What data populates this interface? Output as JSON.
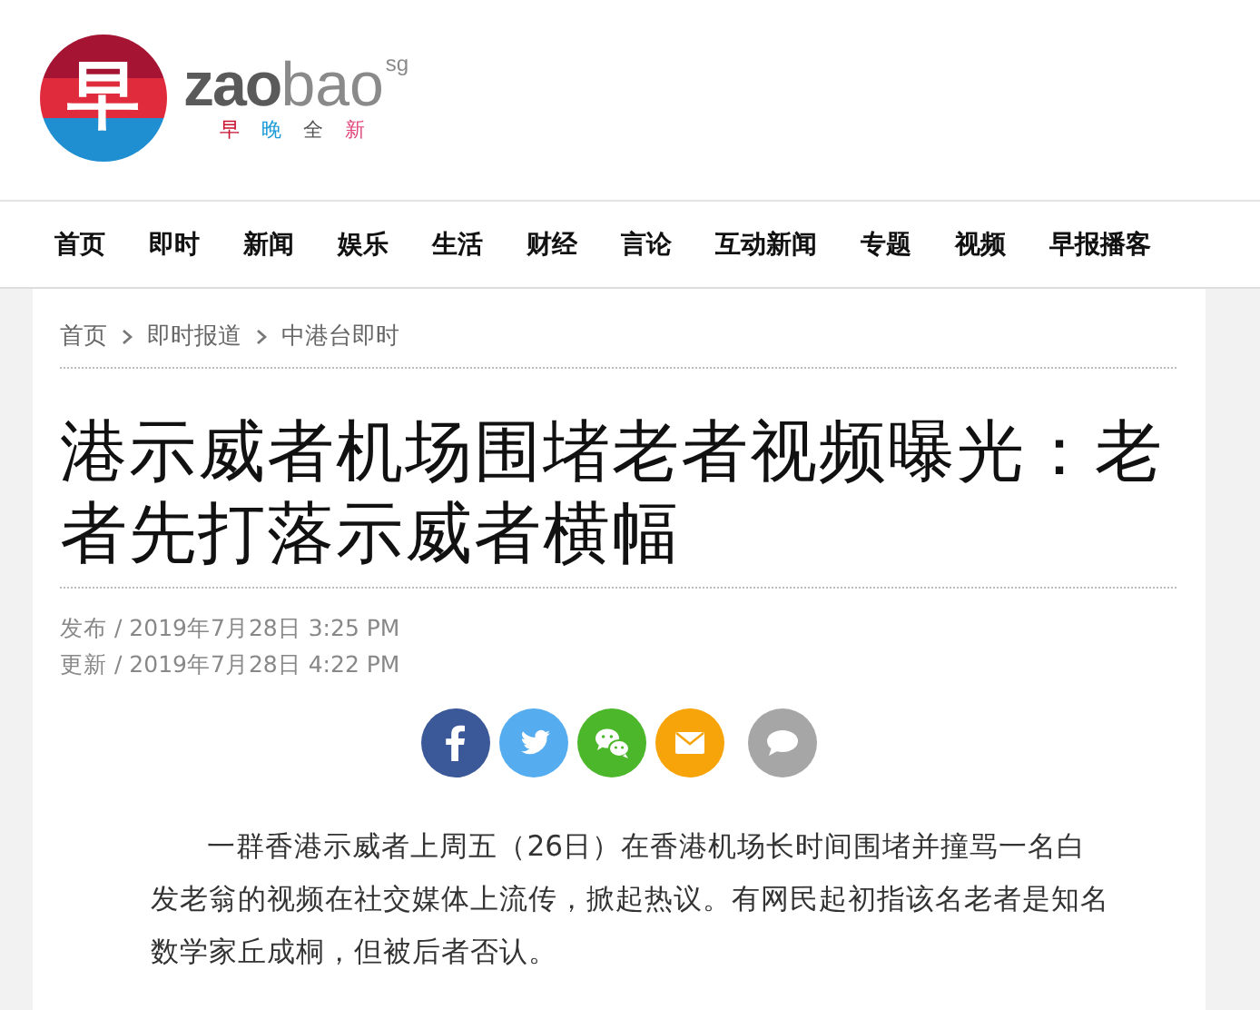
{
  "logo": {
    "mark": "早",
    "name_bold": "zao",
    "name_light": "bao",
    "superscript": "sg",
    "tagline": [
      {
        "text": "早",
        "color": "#c8102e"
      },
      {
        "text": "晚",
        "color": "#1a9ad6"
      },
      {
        "text": "全",
        "color": "#555555"
      },
      {
        "text": "新",
        "color": "#e0457b"
      }
    ]
  },
  "nav": [
    "首页",
    "即时",
    "新闻",
    "娱乐",
    "生活",
    "财经",
    "言论",
    "互动新闻",
    "专题",
    "视频",
    "早报播客"
  ],
  "breadcrumb": [
    "首页",
    "即时报道",
    "中港台即时"
  ],
  "article": {
    "title": "港示威者机场围堵老者视频曝光：老者先打落示威者横幅",
    "meta": [
      {
        "label": "发布",
        "value": "/ 2019年7月28日 3:25 PM"
      },
      {
        "label": "更新",
        "value": "/ 2019年7月28日 4:22 PM"
      }
    ],
    "share": [
      {
        "kind": "facebook",
        "color": "#3b5998"
      },
      {
        "kind": "twitter",
        "color": "#55acee"
      },
      {
        "kind": "wechat",
        "color": "#4cb72b"
      },
      {
        "kind": "email",
        "color": "#f7a30a"
      },
      {
        "kind": "comment",
        "color": "#a6a6a6"
      }
    ],
    "body": "一群香港示威者上周五（26日）在香港机场长时间围堵并撞骂一名白发老翁的视频在社交媒体上流传，掀起热议。有网民起初指该名老者是知名数学家丘成桐，但被后者否认。"
  }
}
